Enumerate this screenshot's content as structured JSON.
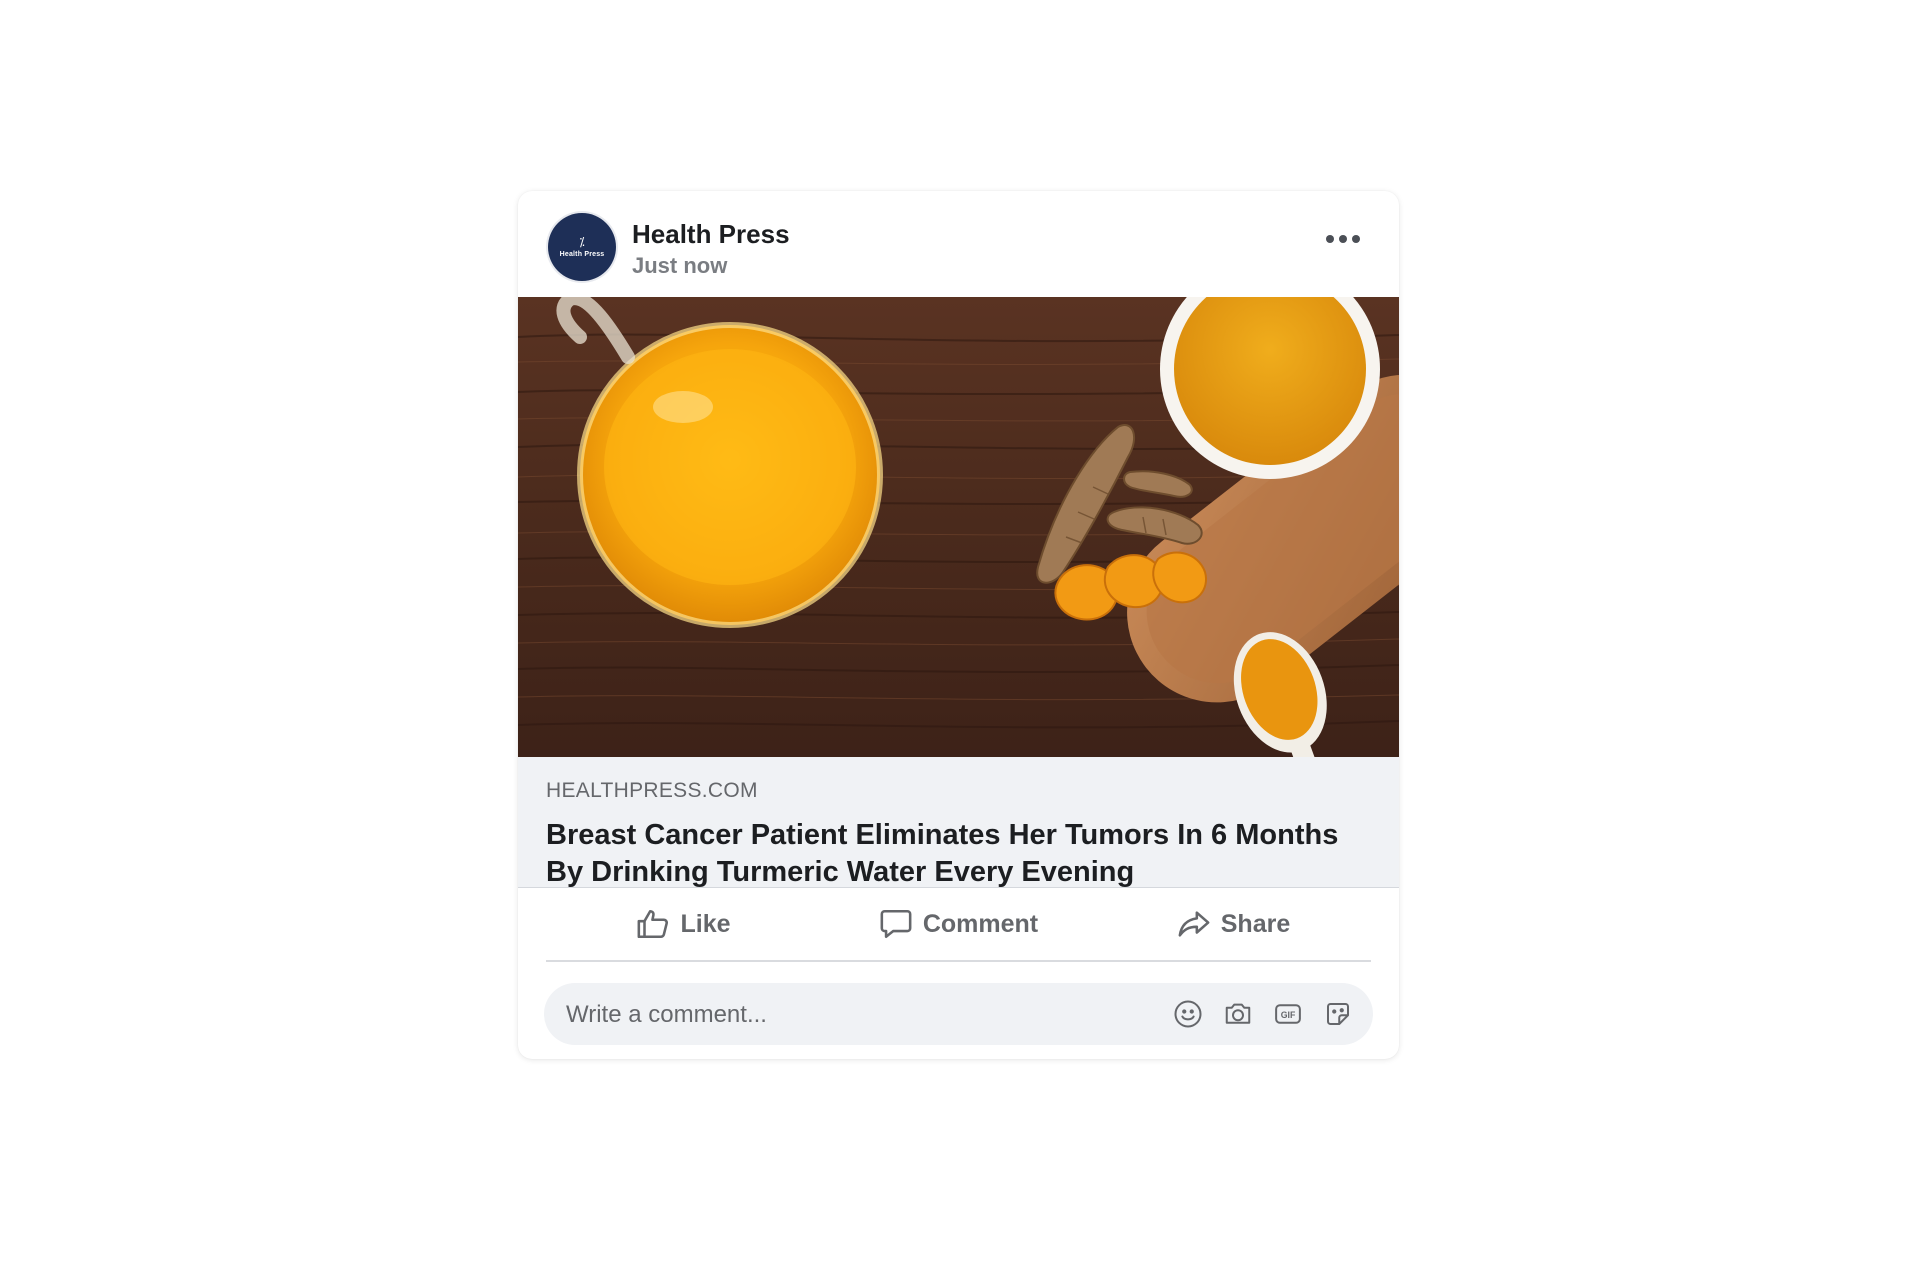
{
  "post": {
    "author": "Health Press",
    "avatar_mark": "⁒",
    "avatar_text": "Health Press",
    "timestamp": "Just now",
    "more_icon": "more-horizontal-icon"
  },
  "link": {
    "domain": "HEALTHPRESS.COM",
    "headline": "Breast Cancer Patient Eliminates Her Tumors In 6 Months By Drinking Turmeric Water Every Evening",
    "image_subject": "turmeric-water-photo"
  },
  "actions": {
    "like_label": "Like",
    "comment_label": "Comment",
    "share_label": "Share"
  },
  "comment": {
    "placeholder": "Write a comment...",
    "icons": [
      "emoji-icon",
      "camera-icon",
      "gif-icon",
      "sticker-icon"
    ]
  },
  "colors": {
    "avatar_bg": "#1e2f57",
    "link_bg": "#f0f2f5",
    "muted_text": "#65676b",
    "primary_text": "#1c1e21"
  }
}
